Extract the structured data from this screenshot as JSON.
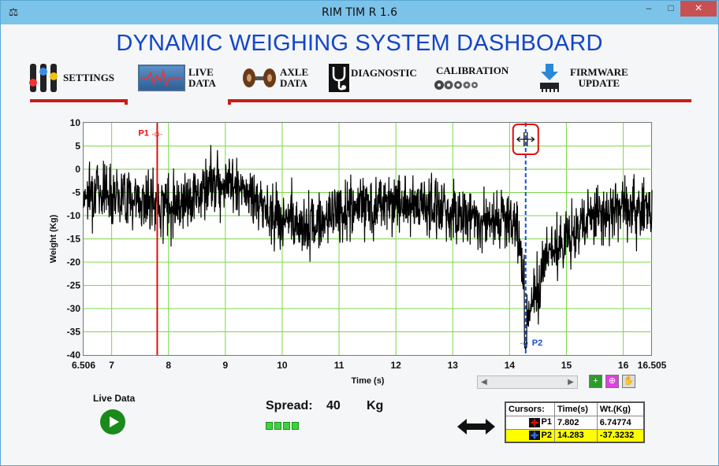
{
  "window": {
    "title": "RIM TIM R 1.6",
    "min": "–",
    "max": "□",
    "close": "×"
  },
  "dashboard_title": "DYNAMIC WEIGHING SYSTEM DASHBOARD",
  "nav": {
    "settings": "SETTINGS",
    "live_1": "LIVE",
    "live_2": "DATA",
    "axle_1": "AXLE",
    "axle_2": "DATA",
    "diagnostic": "DIAGNOSTIC",
    "calibration": "CALIBRATION",
    "firmware_1": "FIRMWARE",
    "firmware_2": "UPDATE"
  },
  "chart_data": {
    "type": "line",
    "xlabel": "Time (s)",
    "ylabel": "Weight (Kg)",
    "xlim": [
      6.506,
      16.505
    ],
    "ylim": [
      -40,
      10
    ],
    "x_ticks": [
      "6.506",
      "7",
      "8",
      "9",
      "10",
      "11",
      "12",
      "13",
      "14",
      "15",
      "16",
      "16.505"
    ],
    "y_ticks": [
      "10",
      "5",
      "0",
      "-5",
      "-10",
      "-15",
      "-20",
      "-25",
      "-30",
      "-35",
      "-40"
    ],
    "grid": true,
    "series": [
      {
        "name": "",
        "color": "#000000"
      }
    ],
    "cursors": [
      {
        "name": "P1",
        "time": 7.802,
        "color": "#e01010"
      },
      {
        "name": "P2",
        "time": 14.283,
        "color": "#1a4fd0"
      }
    ]
  },
  "live_data_label": "Live Data",
  "spread": {
    "label": "Spread:",
    "value": "40",
    "unit": "Kg"
  },
  "cursor_table": {
    "headers": [
      "Cursors:",
      "Time(s)",
      "Wt.(Kg)"
    ],
    "rows": [
      {
        "name": "P1",
        "time": "7.802",
        "weight": "6.74774"
      },
      {
        "name": "P2",
        "time": "14.283",
        "weight": "-37.3232"
      }
    ]
  }
}
